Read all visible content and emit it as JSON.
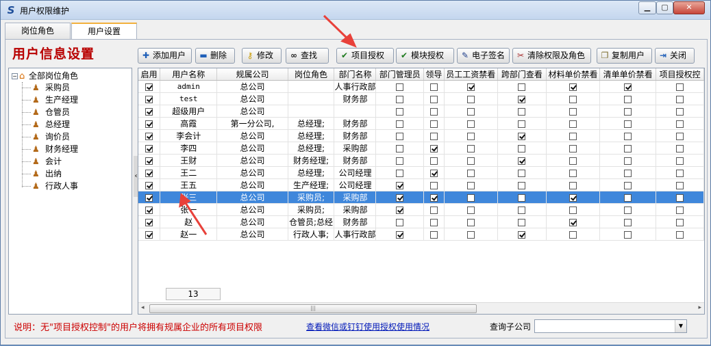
{
  "window": {
    "title": "用户权限维护"
  },
  "tabs": [
    {
      "label": "岗位角色"
    },
    {
      "label": "用户设置"
    }
  ],
  "heading": "用户信息设置",
  "toolbar": [
    {
      "label": "添加用户",
      "icon": "plus-icon",
      "glyph": "✚",
      "color": "#1f5fb8"
    },
    {
      "label": "删除",
      "icon": "minus-icon",
      "glyph": "▬",
      "color": "#1f5fb8"
    },
    {
      "label": "修改",
      "icon": "key-icon",
      "glyph": "⚷",
      "color": "#c99a00"
    },
    {
      "label": "查找",
      "icon": "binoculars-icon",
      "glyph": "∞",
      "color": "#222"
    },
    {
      "label": "项目授权",
      "icon": "check-icon",
      "glyph": "✔",
      "color": "#1d7a1d"
    },
    {
      "label": "模块授权",
      "icon": "check-icon",
      "glyph": "✔",
      "color": "#1d7a1d"
    },
    {
      "label": "电子签名",
      "icon": "pen-icon",
      "glyph": "✎",
      "color": "#1f3f8a"
    },
    {
      "label": "清除权限及角色",
      "icon": "broom-icon",
      "glyph": "✂",
      "color": "#a33"
    },
    {
      "label": "复制用户",
      "icon": "copy-icon",
      "glyph": "❐",
      "color": "#7a6a2a"
    },
    {
      "label": "关闭",
      "icon": "exit-icon",
      "glyph": "⇥",
      "color": "#1f5fb8"
    }
  ],
  "tree": {
    "root": "全部岗位角色",
    "items": [
      "采购员",
      "生产经理",
      "仓管员",
      "总经理",
      "询价员",
      "财务经理",
      "会计",
      "出纳",
      "行政人事"
    ]
  },
  "grid": {
    "columns": [
      "启用",
      "用户名称",
      "规属公司",
      "岗位角色",
      "部门名称",
      "部门管理员",
      "领导",
      "员工工资禁看",
      "跨部门查看",
      "材料单价禁看",
      "清单单价禁看",
      "项目授权控"
    ],
    "rows": [
      {
        "enabled": true,
        "name": "admin",
        "company": "总公司",
        "role": "",
        "dept": "人事行政部",
        "checks": [
          false,
          false,
          true,
          false,
          true,
          true,
          false
        ]
      },
      {
        "enabled": true,
        "name": "test",
        "company": "总公司",
        "role": "",
        "dept": "财务部",
        "checks": [
          false,
          false,
          false,
          true,
          false,
          false,
          false
        ]
      },
      {
        "enabled": true,
        "name": "超级用户",
        "company": "总公司",
        "role": "",
        "dept": "",
        "checks": [
          false,
          false,
          false,
          false,
          false,
          false,
          false
        ]
      },
      {
        "enabled": true,
        "name": "高霞",
        "company": "第一分公司,",
        "role": "总经理;",
        "dept": "财务部",
        "checks": [
          false,
          false,
          false,
          false,
          false,
          false,
          false
        ]
      },
      {
        "enabled": true,
        "name": "李会计",
        "company": "总公司",
        "role": "总经理;",
        "dept": "财务部",
        "checks": [
          false,
          false,
          false,
          true,
          false,
          false,
          false
        ]
      },
      {
        "enabled": true,
        "name": "李四",
        "company": "总公司",
        "role": "总经理;",
        "dept": "采购部",
        "checks": [
          false,
          true,
          false,
          false,
          false,
          false,
          false
        ]
      },
      {
        "enabled": true,
        "name": "王财",
        "company": "总公司",
        "role": "财务经理;",
        "dept": "财务部",
        "checks": [
          false,
          false,
          false,
          true,
          false,
          false,
          false
        ]
      },
      {
        "enabled": true,
        "name": "王二",
        "company": "总公司",
        "role": "总经理;",
        "dept": "公司经理",
        "checks": [
          false,
          true,
          false,
          false,
          false,
          false,
          false
        ]
      },
      {
        "enabled": true,
        "name": "王五",
        "company": "总公司",
        "role": "生产经理;",
        "dept": "公司经理",
        "checks": [
          true,
          false,
          false,
          false,
          false,
          false,
          false
        ]
      },
      {
        "enabled": true,
        "name": "张三",
        "company": "总公司",
        "role": "采购员;",
        "dept": "采购部",
        "checks": [
          true,
          true,
          false,
          false,
          true,
          false,
          false
        ],
        "selected": true
      },
      {
        "enabled": true,
        "name": "张一",
        "company": "总公司",
        "role": "采购员;",
        "dept": "采购部",
        "checks": [
          true,
          false,
          false,
          false,
          false,
          false,
          false
        ]
      },
      {
        "enabled": true,
        "name": "赵",
        "company": "总公司",
        "role": "仓管员;总经",
        "dept": "财务部",
        "checks": [
          false,
          false,
          false,
          false,
          true,
          false,
          false
        ]
      },
      {
        "enabled": true,
        "name": "赵一",
        "company": "总公司",
        "role": "行政人事;",
        "dept": "人事行政部",
        "checks": [
          true,
          false,
          false,
          true,
          false,
          false,
          false
        ]
      }
    ],
    "count": "13"
  },
  "footer": {
    "note": "说明：无\"项目授权控制\"的用户将拥有规属企业的所有项目权限",
    "link": "查看微信或钉钉使用授权使用情况",
    "subcompany_label": "查询子公司",
    "subcompany_value": ""
  },
  "colors": {
    "selected_row": "#3f87db",
    "heading": "#b80000",
    "annotation_arrow": "#e8413a"
  }
}
